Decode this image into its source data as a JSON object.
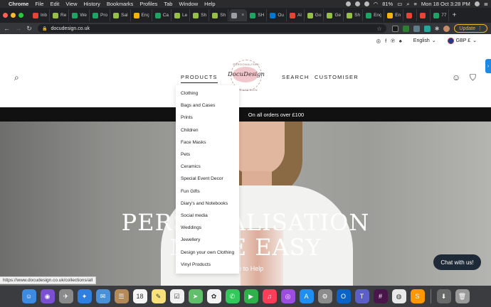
{
  "menubar": {
    "app": "Chrome",
    "items": [
      "File",
      "Edit",
      "View",
      "History",
      "Bookmarks",
      "Profiles",
      "Tab",
      "Window",
      "Help"
    ],
    "battery": "81%",
    "datetime": "Mon 18 Oct  3:28 PM"
  },
  "tabs": [
    {
      "label": "Inb",
      "color": "#ea4335"
    },
    {
      "label": "Re",
      "color": "#96bf48"
    },
    {
      "label": "We",
      "color": "#1fa463"
    },
    {
      "label": "Pro",
      "color": "#1fa463"
    },
    {
      "label": "Sal",
      "color": "#96bf48"
    },
    {
      "label": "Enç",
      "color": "#f4b400"
    },
    {
      "label": "Ca",
      "color": "#1fa463"
    },
    {
      "label": "Le",
      "color": "#96bf48"
    },
    {
      "label": "Sh",
      "color": "#96bf48"
    },
    {
      "label": "Sh",
      "color": "#96bf48"
    },
    {
      "label": "",
      "color": "#9aa0a6",
      "active": true
    },
    {
      "label": "SH",
      "color": "#1fa463"
    },
    {
      "label": "Ou",
      "color": "#0078d4"
    },
    {
      "label": "Al",
      "color": "#ea4335"
    },
    {
      "label": "Go",
      "color": "#96bf48"
    },
    {
      "label": "Ge",
      "color": "#96bf48"
    },
    {
      "label": "Sh",
      "color": "#96bf48"
    },
    {
      "label": "Enç",
      "color": "#1fa463"
    },
    {
      "label": "En",
      "color": "#f4b400"
    },
    {
      "label": "",
      "color": "#ea4335"
    },
    {
      "label": "",
      "color": "#ea4335"
    },
    {
      "label": "77",
      "color": "#1fa463"
    }
  ],
  "address": {
    "url": "docudesign.co.uk",
    "update_label": "Update"
  },
  "utility": {
    "language": "English",
    "currency": "GBP £"
  },
  "nav": {
    "products": "PRODUCTS",
    "search": "SEARCH",
    "customiser": "CUSTOMISER"
  },
  "logo": {
    "text": "DocuDesign",
    "ring_top": "PERSONALISED",
    "ring_bottom": "DOCUDESIGN"
  },
  "announcement": "On all orders over £100",
  "dropdown": {
    "items": [
      "Clothing",
      "Bags and Cases",
      "Prints",
      "Children",
      "Face Masks",
      "Pets",
      "Ceramics",
      "Special Event Decor",
      "Fun Gifts",
      "Diary's and Notebooks",
      "Social media",
      "Weddings",
      "Jewellery",
      "Design your own Clothing",
      "Vinyl Products"
    ]
  },
  "hero": {
    "line1": "PERSONALISATION",
    "line2": "MADE EASY",
    "subtitle": "Here to Help"
  },
  "chat_label": "Chat with us!",
  "status_url": "https://www.docudesign.co.uk/collections/all",
  "dock": [
    {
      "name": "finder-icon",
      "color": "#3d8be0",
      "glyph": "☺"
    },
    {
      "name": "siri-icon",
      "color": "#7a4fd1",
      "glyph": "◉"
    },
    {
      "name": "launchpad-icon",
      "color": "#8a8a8a",
      "glyph": "✈"
    },
    {
      "name": "safari-icon",
      "color": "#2f7fe0",
      "glyph": "✦"
    },
    {
      "name": "mail-icon",
      "color": "#4a90d9",
      "glyph": "✉"
    },
    {
      "name": "contacts-icon",
      "color": "#b38a58",
      "glyph": "☰"
    },
    {
      "name": "calendar-icon",
      "color": "#f5f5f5",
      "glyph": "18"
    },
    {
      "name": "notes-icon",
      "color": "#f7e27a",
      "glyph": "✎"
    },
    {
      "name": "reminders-icon",
      "color": "#f0f0f0",
      "glyph": "☑"
    },
    {
      "name": "maps-icon",
      "color": "#5fbf6a",
      "glyph": "➤"
    },
    {
      "name": "photos-icon",
      "color": "#f3f3f3",
      "glyph": "✿"
    },
    {
      "name": "messages-icon",
      "color": "#34c759",
      "glyph": "✆"
    },
    {
      "name": "facetime-icon",
      "color": "#30b04a",
      "glyph": "▶"
    },
    {
      "name": "music-icon",
      "color": "#fa3e58",
      "glyph": "♫"
    },
    {
      "name": "podcasts-icon",
      "color": "#9b4de0",
      "glyph": "◎"
    },
    {
      "name": "appstore-icon",
      "color": "#1e8ff0",
      "glyph": "A"
    },
    {
      "name": "system-preferences-icon",
      "color": "#8c8c8c",
      "glyph": "⚙"
    },
    {
      "name": "outlook-icon",
      "color": "#0a64c8",
      "glyph": "O"
    },
    {
      "name": "teams-icon",
      "color": "#5b5fc7",
      "glyph": "T"
    },
    {
      "name": "slack-icon",
      "color": "#4a154b",
      "glyph": "#"
    },
    {
      "name": "chrome-icon",
      "color": "#e8e8e8",
      "glyph": "◍"
    },
    {
      "name": "sublime-icon",
      "color": "#ff9800",
      "glyph": "S"
    },
    {
      "name": "downloads-icon",
      "color": "#6a6a6a",
      "glyph": "⬇"
    },
    {
      "name": "trash-icon",
      "color": "#9a9a9a",
      "glyph": "🗑"
    }
  ]
}
